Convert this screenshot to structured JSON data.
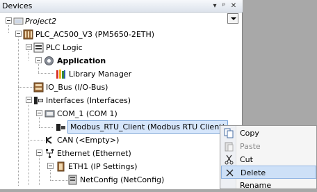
{
  "panel": {
    "title": "Devices"
  },
  "tree": {
    "project": "Project2",
    "plc": "PLC_AC500_V3 (PM5650-2ETH)",
    "plc_logic": "PLC Logic",
    "application": "Application",
    "library_manager": "Library Manager",
    "io_bus": "IO_Bus (I/O-Bus)",
    "interfaces": "Interfaces (Interfaces)",
    "com1": "COM_1 (COM 1)",
    "modbus": "Modbus_RTU_Client (Modbus RTU Client)",
    "can": "CAN (<Empty>)",
    "ethernet": "Ethernet (Ethernet)",
    "eth1": "ETH1 (IP Settings)",
    "netconfig": "NetConfig (NetConfig)"
  },
  "context_menu": {
    "items": [
      {
        "label": "Copy",
        "icon": "copy-icon",
        "enabled": true
      },
      {
        "label": "Paste",
        "icon": "paste-icon",
        "enabled": false
      },
      {
        "label": "Cut",
        "icon": "cut-icon",
        "enabled": true
      },
      {
        "label": "Delete",
        "icon": "delete-icon",
        "enabled": true,
        "hovered": true
      },
      {
        "label": "Rename",
        "icon": "",
        "enabled": true
      }
    ]
  },
  "colors": {
    "selection": "#d6e6fb",
    "menu_hover": "#cde0f7",
    "background": "#a8a8a8"
  }
}
